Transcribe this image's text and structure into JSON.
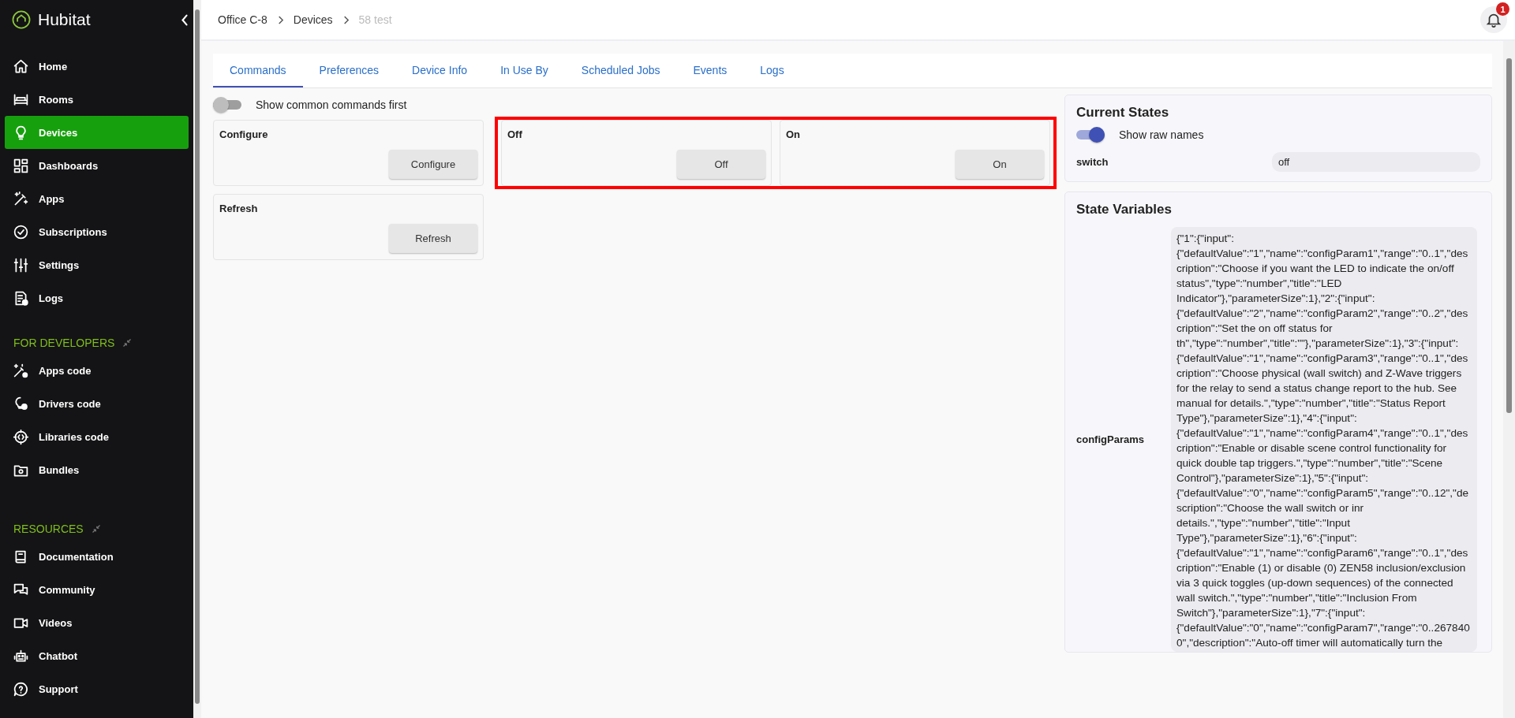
{
  "sidebar": {
    "brand": "Hubitat",
    "items": [
      {
        "label": "Home",
        "selected": false
      },
      {
        "label": "Rooms",
        "selected": false
      },
      {
        "label": "Devices",
        "selected": true
      },
      {
        "label": "Dashboards",
        "selected": false
      },
      {
        "label": "Apps",
        "selected": false
      },
      {
        "label": "Subscriptions",
        "selected": false
      },
      {
        "label": "Settings",
        "selected": false
      },
      {
        "label": "Logs",
        "selected": false
      }
    ],
    "sections": [
      {
        "title": "FOR DEVELOPERS",
        "items": [
          {
            "label": "Apps code",
            "selected": false
          },
          {
            "label": "Drivers code",
            "selected": false
          },
          {
            "label": "Libraries code",
            "selected": false
          },
          {
            "label": "Bundles",
            "selected": false
          }
        ]
      },
      {
        "title": "RESOURCES",
        "items": [
          {
            "label": "Documentation",
            "selected": false
          },
          {
            "label": "Community",
            "selected": false
          },
          {
            "label": "Videos",
            "selected": false
          },
          {
            "label": "Chatbot",
            "selected": false
          },
          {
            "label": "Support",
            "selected": false
          }
        ]
      }
    ]
  },
  "breadcrumb": [
    {
      "label": "Office C-8",
      "current": false
    },
    {
      "label": "Devices",
      "current": false
    },
    {
      "label": "58 test",
      "current": true
    }
  ],
  "notifications": {
    "count": "1"
  },
  "tabs": [
    {
      "label": "Commands",
      "selected": true
    },
    {
      "label": "Preferences",
      "selected": false
    },
    {
      "label": "Device Info",
      "selected": false
    },
    {
      "label": "In Use By",
      "selected": false
    },
    {
      "label": "Scheduled Jobs",
      "selected": false
    },
    {
      "label": "Events",
      "selected": false
    },
    {
      "label": "Logs",
      "selected": false
    }
  ],
  "common_first": {
    "label": "Show common commands first",
    "on": false
  },
  "commands": [
    {
      "title": "Configure",
      "button": "Configure",
      "highlighted": false
    },
    {
      "title": "Off",
      "button": "Off",
      "highlighted": true
    },
    {
      "title": "On",
      "button": "On",
      "highlighted": true
    },
    {
      "title": "Refresh",
      "button": "Refresh",
      "highlighted": false
    }
  ],
  "current_states": {
    "title": "Current States",
    "raw_names": {
      "label": "Show raw names",
      "on": true
    },
    "rows": [
      {
        "name": "switch",
        "value": "off"
      }
    ]
  },
  "state_variables": {
    "title": "State Variables",
    "rows": [
      {
        "name": "configParams",
        "value": "{\"1\":{\"input\":{\"defaultValue\":\"1\",\"name\":\"configParam1\",\"range\":\"0..1\",\"description\":\"Choose if you want the LED to indicate the on/off status\",\"type\":\"number\",\"title\":\"LED Indicator\"},\"parameterSize\":1},\"2\":{\"input\":{\"defaultValue\":\"2\",\"name\":\"configParam2\",\"range\":\"0..2\",\"description\":\"Set the on off status for th\",\"type\":\"number\",\"title\":\"\"},\"parameterSize\":1},\"3\":{\"input\":{\"defaultValue\":\"1\",\"name\":\"configParam3\",\"range\":\"0..1\",\"description\":\"Choose physical (wall switch) and Z-Wave triggers for the relay to send a status change report to the hub. See manual for details.\",\"type\":\"number\",\"title\":\"Status Report Type\"},\"parameterSize\":1},\"4\":{\"input\":{\"defaultValue\":\"1\",\"name\":\"configParam4\",\"range\":\"0..1\",\"description\":\"Enable or disable scene control functionality for quick double tap triggers.\",\"type\":\"number\",\"title\":\"Scene Control\"},\"parameterSize\":1},\"5\":{\"input\":{\"defaultValue\":\"0\",\"name\":\"configParam5\",\"range\":\"0..12\",\"description\":\"Choose the wall switch or inr details.\",\"type\":\"number\",\"title\":\"Input Type\"},\"parameterSize\":1},\"6\":{\"input\":{\"defaultValue\":\"1\",\"name\":\"configParam6\",\"range\":\"0..1\",\"description\":\"Enable (1) or disable (0) ZEN58 inclusion/exclusion via 3 quick toggles (up-down sequences) of the connected wall switch.\",\"type\":\"number\",\"title\":\"Inclusion From Switch\"},\"parameterSize\":1},\"7\":{\"input\":{\"defaultValue\":\"0\",\"name\":\"configParam7\",\"range\":\"0..2678400\",\"description\":\"Auto-off timer will automatically turn the"
      }
    ]
  }
}
